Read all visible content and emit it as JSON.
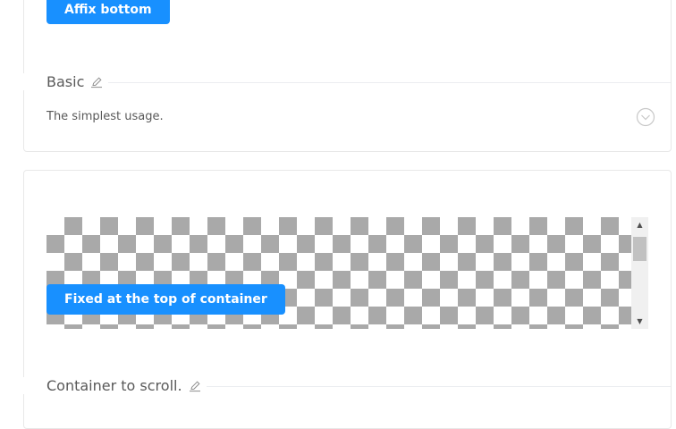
{
  "basic_demo": {
    "affix_button_label": "Affix bottom",
    "title": "Basic",
    "description": "The simplest usage."
  },
  "container_demo": {
    "fixed_button_label": "Fixed at the top of container",
    "title": "Container to scroll."
  },
  "icons": {
    "edit": "edit-icon",
    "expand": "expand-code-icon",
    "scroll_up": "up-arrow",
    "scroll_down": "down-arrow"
  },
  "colors": {
    "primary": "#1890ff",
    "checker": "#a9a9a9",
    "border": "#e8e8e8"
  }
}
